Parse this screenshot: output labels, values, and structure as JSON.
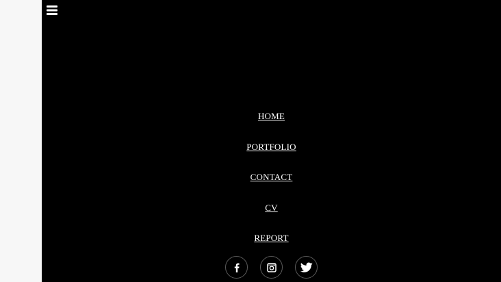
{
  "menu": {
    "items": [
      {
        "label": "HOME"
      },
      {
        "label": "PORTFOLIO"
      },
      {
        "label": "CONTACT"
      },
      {
        "label": "CV"
      },
      {
        "label": "REPORT"
      }
    ]
  },
  "social": {
    "icons": [
      "facebook-icon",
      "instagram-icon",
      "twitter-icon"
    ]
  },
  "colors": {
    "overlay_background": "#000000",
    "page_background": "#f7f7f7",
    "link_text": "#ffffff",
    "icon_border": "#5a5a5a"
  }
}
